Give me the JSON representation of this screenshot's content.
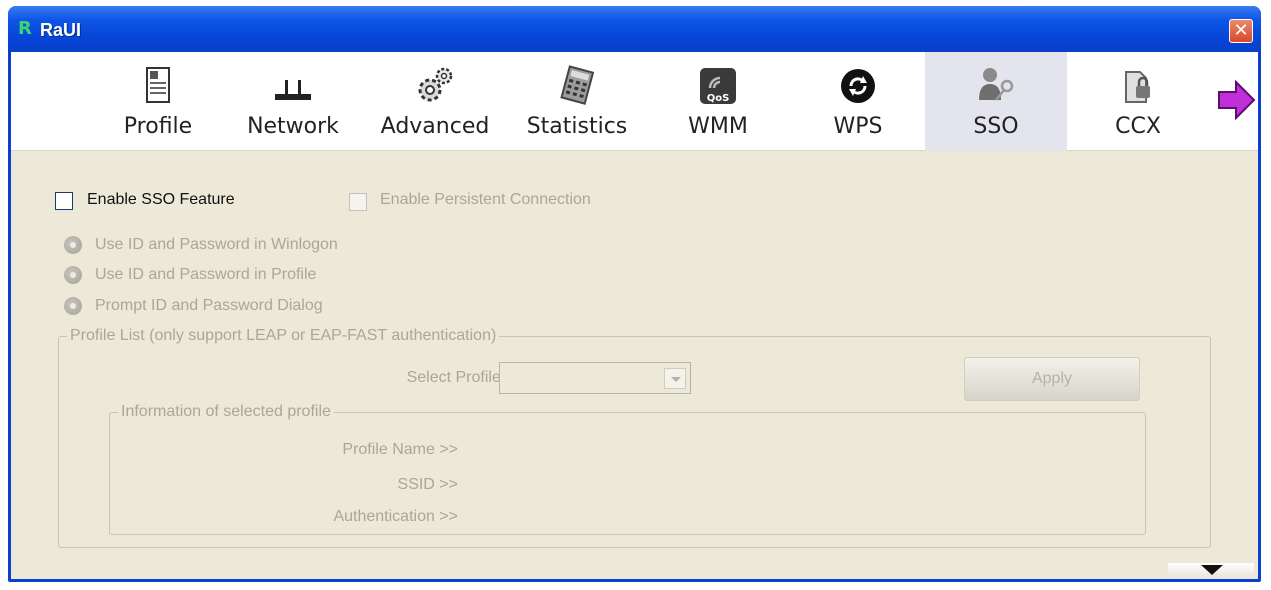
{
  "window": {
    "title": "RaUI",
    "logo_glyph": "R"
  },
  "toolbar": {
    "items": [
      {
        "label": "Profile",
        "icon": "profile-icon"
      },
      {
        "label": "Network",
        "icon": "network-icon"
      },
      {
        "label": "Advanced",
        "icon": "advanced-gears-icon"
      },
      {
        "label": "Statistics",
        "icon": "statistics-icon"
      },
      {
        "label": "WMM",
        "icon": "qos-icon"
      },
      {
        "label": "WPS",
        "icon": "wps-icon"
      },
      {
        "label": "SSO",
        "icon": "sso-keys-icon"
      },
      {
        "label": "CCX",
        "icon": "ccx-lock-icon"
      }
    ],
    "active": "SSO",
    "next_icon": "next-arrow-icon"
  },
  "sso": {
    "enable_label": "Enable SSO Feature",
    "enable_checked": false,
    "persistent_label": "Enable Persistent Connection",
    "options": [
      "Use ID and Password in Winlogon",
      "Use ID and Password in Profile",
      "Prompt ID and Password Dialog"
    ],
    "profile_list": {
      "legend": "Profile List (only support LEAP or EAP-FAST authentication)",
      "select_label": "Select Profile >>",
      "select_value": "",
      "apply_label": "Apply",
      "info": {
        "legend": "Information of selected profile",
        "profile_name_label": "Profile Name >>",
        "ssid_label": "SSID >>",
        "authentication_label": "Authentication >>"
      }
    }
  },
  "colors": {
    "titlebar": "#0645d8",
    "client_bg": "#ece9d8",
    "disabled_text": "#a9a79c",
    "active_tab_bg": "#e3e4ee"
  }
}
